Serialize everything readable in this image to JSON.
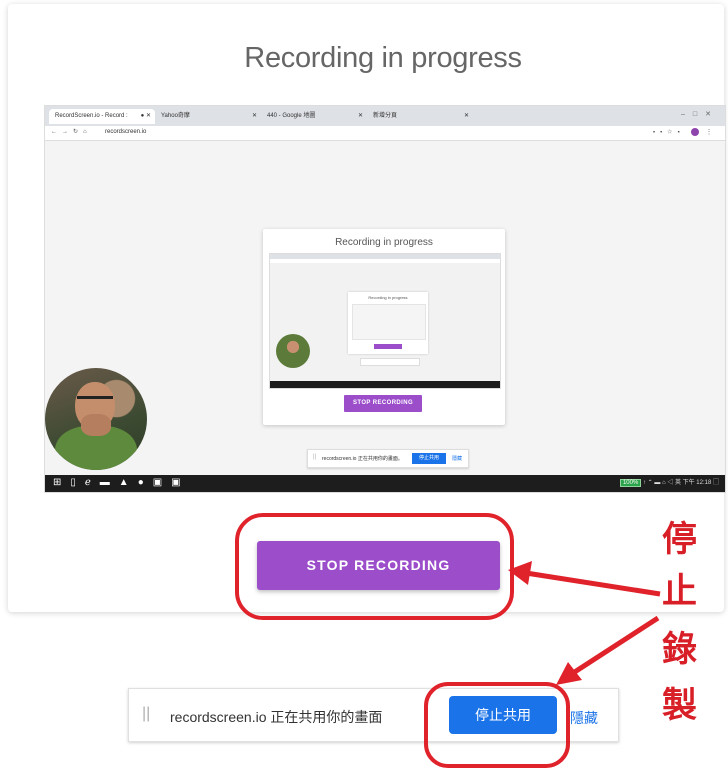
{
  "page": {
    "title": "Recording in progress"
  },
  "preview": {
    "tabs": [
      {
        "label": "RecordScreen.io - Record :",
        "active": true
      },
      {
        "label": "Yahoo奇摩"
      },
      {
        "label": "440 - Google 地圖"
      },
      {
        "label": "新增分頁"
      }
    ],
    "url": "recordscreen.io",
    "inner_title": "Recording in progress",
    "inner_stop_label": "STOP RECORDING",
    "inner_notice": {
      "text": "recordscreen.io 正在共用你的畫面。",
      "stop_label": "停止共用",
      "hide_label": "隱藏"
    },
    "taskbar": {
      "battery": "100%",
      "time": "下午 12:18"
    }
  },
  "main": {
    "stop_label": "STOP RECORDING"
  },
  "annotation": {
    "text": [
      "停",
      "止",
      "錄",
      "製"
    ],
    "color": "#e0222b"
  },
  "share_bar": {
    "text": "recordscreen.io 正在共用你的畫面",
    "stop_label": "停止共用",
    "hide_label": "隱藏"
  },
  "colors": {
    "accent": "#9b4dca",
    "share_blue": "#1a73e8"
  }
}
